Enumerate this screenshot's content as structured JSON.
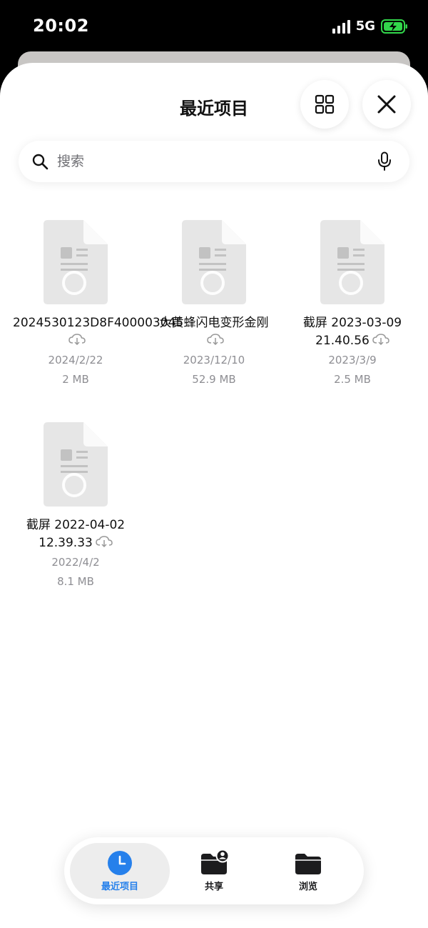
{
  "status_bar": {
    "time": "20:02",
    "network": "5G"
  },
  "header": {
    "title": "最近项目"
  },
  "search": {
    "placeholder": "搜索"
  },
  "files": [
    {
      "name": "2024530123D8F400003045",
      "date": "2024/2/22",
      "size": "2 MB"
    },
    {
      "name": "大黄蜂闪电变形金刚",
      "date": "2023/12/10",
      "size": "52.9 MB"
    },
    {
      "name": "截屏 2023-03-09 21.40.56",
      "date": "2023/3/9",
      "size": "2.5 MB"
    },
    {
      "name": "截屏 2022-04-02 12.39.33",
      "date": "2022/4/2",
      "size": "8.1 MB"
    }
  ],
  "tabs": [
    {
      "label": "最近项目",
      "icon": "clock-icon",
      "active": true
    },
    {
      "label": "共享",
      "icon": "shared-folder-icon",
      "active": false
    },
    {
      "label": "浏览",
      "icon": "folder-icon",
      "active": false
    }
  ],
  "colors": {
    "accent": "#2680eb",
    "battery": "#32d74b",
    "secondary_text": "#8e8e93"
  }
}
